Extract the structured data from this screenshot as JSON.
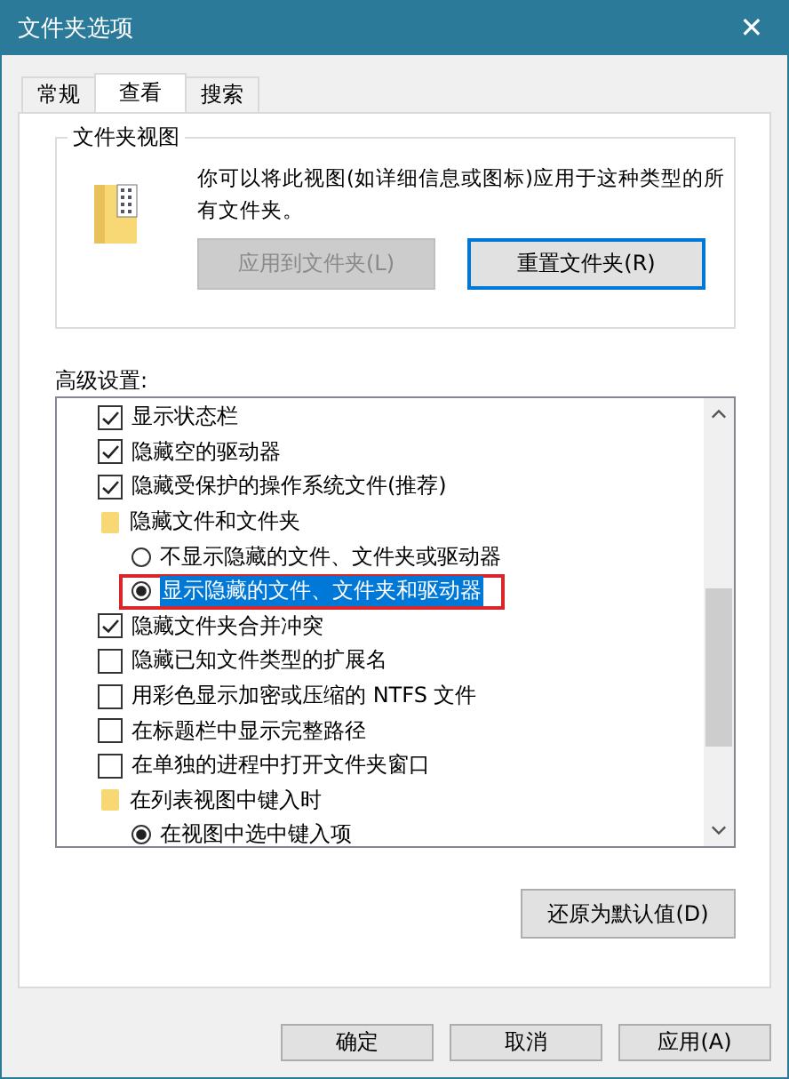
{
  "window": {
    "title": "文件夹选项",
    "close": "✕"
  },
  "tabs": [
    {
      "label": "常规",
      "selected": false
    },
    {
      "label": "查看",
      "selected": true
    },
    {
      "label": "搜索",
      "selected": false
    }
  ],
  "folder_views": {
    "title": "文件夹视图",
    "description": "你可以将此视图(如详细信息或图标)应用于这种类型的所有文件夹。",
    "buttons": [
      {
        "label": "应用到文件夹(L)",
        "disabled": true,
        "focused": false
      },
      {
        "label": "重置文件夹(R)",
        "disabled": false,
        "focused": true
      }
    ]
  },
  "advanced": {
    "label": "高级设置:",
    "items": [
      {
        "kind": "checkbox",
        "label": "显示状态栏",
        "checked": true
      },
      {
        "kind": "checkbox",
        "label": "隐藏空的驱动器",
        "checked": true
      },
      {
        "kind": "checkbox",
        "label": "隐藏受保护的操作系统文件(推荐)",
        "checked": true
      },
      {
        "kind": "group",
        "label": "隐藏文件和文件夹",
        "children": [
          {
            "kind": "radio",
            "label": "不显示隐藏的文件、文件夹或驱动器",
            "selected": false
          },
          {
            "kind": "radio",
            "label": "显示隐藏的文件、文件夹和驱动器",
            "selected": true,
            "highlighted": true,
            "annotated": true
          }
        ]
      },
      {
        "kind": "checkbox",
        "label": "隐藏文件夹合并冲突",
        "checked": true
      },
      {
        "kind": "checkbox",
        "label": "隐藏已知文件类型的扩展名",
        "checked": false
      },
      {
        "kind": "checkbox",
        "label": "用彩色显示加密或压缩的 NTFS 文件",
        "checked": false
      },
      {
        "kind": "checkbox",
        "label": "在标题栏中显示完整路径",
        "checked": false
      },
      {
        "kind": "checkbox",
        "label": "在单独的进程中打开文件夹窗口",
        "checked": false
      },
      {
        "kind": "group",
        "label": "在列表视图中键入时",
        "children": [
          {
            "kind": "radio",
            "label": "在视图中选中键入项",
            "selected": true
          }
        ]
      }
    ],
    "restore_button": "还原为默认值(D)"
  },
  "buttons": [
    "确定",
    "取消",
    "应用(A)"
  ]
}
